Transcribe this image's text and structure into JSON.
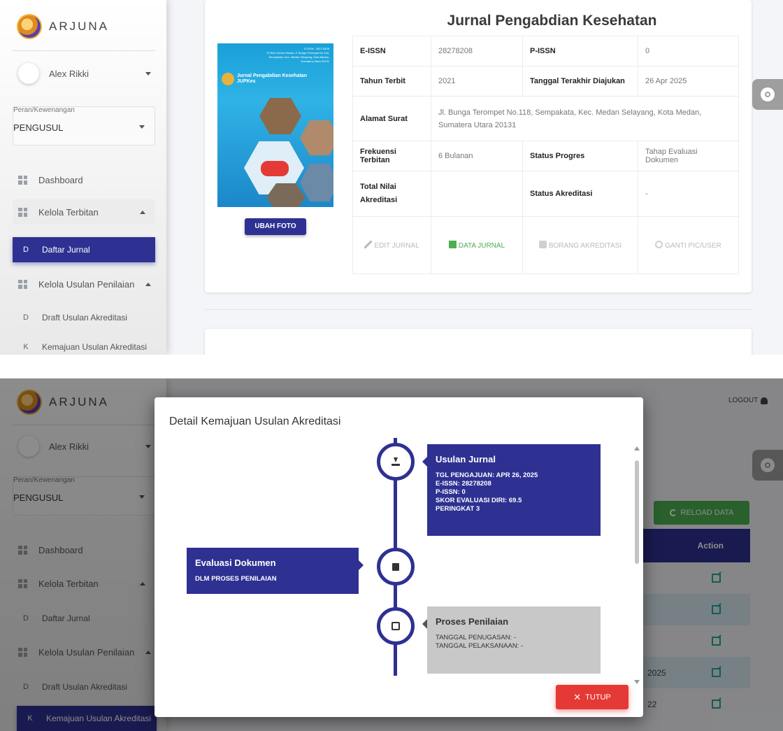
{
  "brand": "ARJUNA",
  "user": {
    "name": "Alex Rikki"
  },
  "role": {
    "label": "Peran/Kewenangan",
    "value": "PENGUSUL"
  },
  "nav": {
    "dashboard": {
      "letter": "",
      "label": "Dashboard"
    },
    "kelola_terbitan": {
      "label": "Kelola Terbitan"
    },
    "daftar_jurnal": {
      "letter": "D",
      "label": "Daftar Jurnal"
    },
    "kelola_usulan": {
      "label": "Kelola Usulan Penilaian"
    },
    "draft_usulan": {
      "letter": "D",
      "label": "Draft Usulan Akreditasi"
    },
    "kemajuan_usulan": {
      "letter": "K",
      "label": "Kemajuan Usulan Akreditasi"
    }
  },
  "journal": {
    "title": "Jurnal Pengabdian Kesehatan",
    "cover": {
      "issn_line": "E-ISSN : 2827-8208",
      "address_line": "STIKes Senior Medan Jl. Bunga Terompet No.118, Sempakata, Kec. Medan Selayang, Kota Medan, Sumatera Utara 20131",
      "name": "Jurnal Pengabdian Kesehatan",
      "abbrev": "JUPKes"
    },
    "upload_button": "UBAH FOTO",
    "fields": {
      "eissn_label": "E-ISSN",
      "eissn_value": "28278208",
      "pissn_label": "P-ISSN",
      "pissn_value": "0",
      "tahun_label": "Tahun Terbit",
      "tahun_value": "2021",
      "tanggal_label": "Tanggal Terakhir Diajukan",
      "tanggal_value": "26 Apr 2025",
      "alamat_label": "Alamat Surat",
      "alamat_value": "Jl. Bunga Terompet No.118, Sempakata, Kec. Medan Selayang, Kota Medan, Sumatera Utara 20131",
      "frekuensi_label": "Frekuensi Terbitan",
      "frekuensi_value": "6 Bulanan",
      "status_label": "Status Progres",
      "status_value": "Tahap Evaluasi Dokumen",
      "nilai_label": "Total Nilai Akreditasi",
      "nilai_value": "",
      "status_akr_label": "Status Akreditasi",
      "status_akr_value": "-"
    },
    "actions": {
      "edit": "EDIT JURNAL",
      "data": "DATA JURNAL",
      "borang": "BORANG AKREDITASI",
      "ganti": "GANTI PIC/USER"
    }
  },
  "header2": {
    "logout": "LOGOUT"
  },
  "reload_button": "RELOAD DATA",
  "table": {
    "action_header": "Action",
    "rows": [
      {
        "text": ""
      },
      {
        "text": ""
      },
      {
        "text": ""
      },
      {
        "text": "2025"
      },
      {
        "text": "22"
      }
    ]
  },
  "modal": {
    "title": "Detail Kemajuan Usulan Akreditasi",
    "usulan": {
      "heading": "Usulan Jurnal",
      "lines": [
        "TGL PENGAJUAN: APR 26, 2025",
        "E-ISSN: 28278208",
        "P-ISSN: 0",
        "SKOR EVALUASI DIRI: 69.5",
        "PERINGKAT 3"
      ]
    },
    "evaluasi": {
      "heading": "Evaluasi Dokumen",
      "status": "DLM PROSES PENILAIAN"
    },
    "proses": {
      "heading": "Proses Penilaian",
      "lines": [
        "TANGGAL PENUGASAN: -",
        "TANGGAL PELAKSANAAN: -"
      ]
    },
    "close_button": "TUTUP"
  },
  "colors": {
    "primary": "#2e3192",
    "success": "#4caf50",
    "danger": "#e53935",
    "teal": "#26a69a"
  }
}
